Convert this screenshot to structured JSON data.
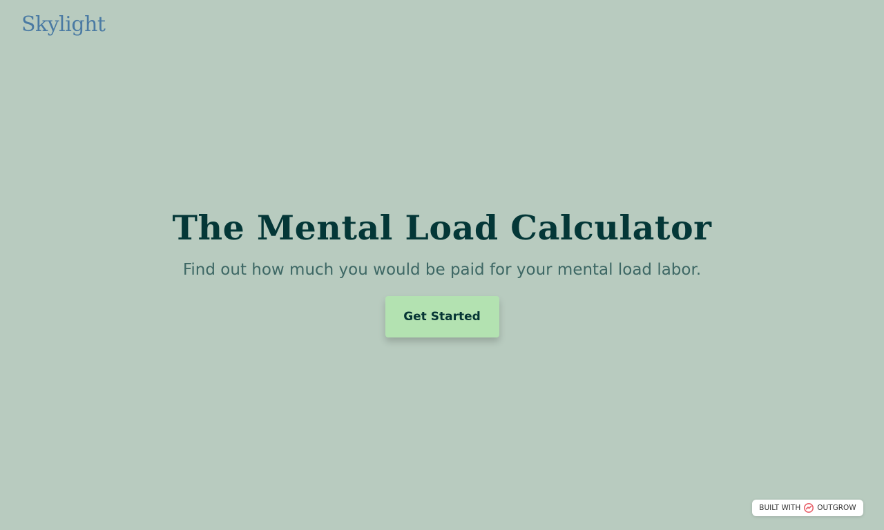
{
  "brand": {
    "logo_text": "Skylight",
    "logo_color": "#4a7aa3"
  },
  "hero": {
    "title": "The Mental Load Calculator",
    "subtitle": "Find out how much you would be paid for your mental load labor.",
    "cta_label": "Get Started"
  },
  "footer_badge": {
    "prefix": "BUILT WITH",
    "brand": "OUTGROW",
    "icon": "outgrow-logo-icon"
  },
  "colors": {
    "background": "#b8cbbf",
    "title": "#043737",
    "subtitle": "#3d6764",
    "cta_background": "#b3e2b1",
    "badge_icon": "#e8626b"
  }
}
